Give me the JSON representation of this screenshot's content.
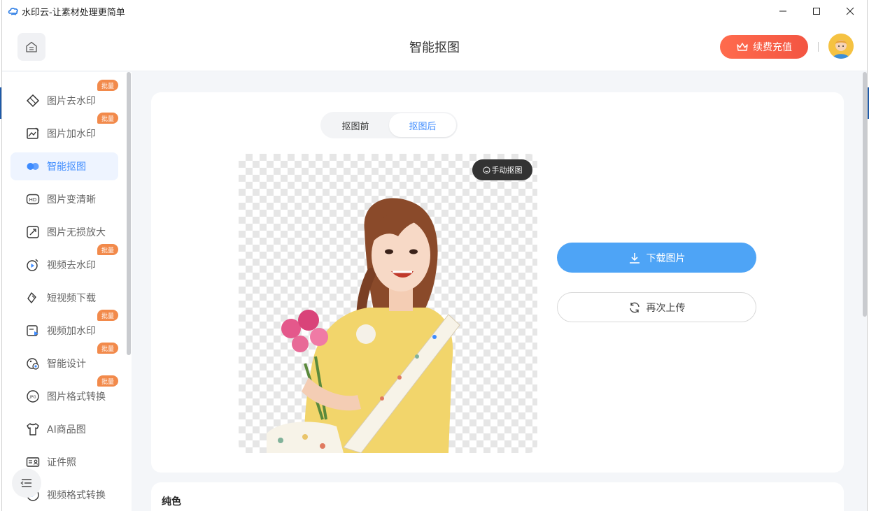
{
  "window": {
    "title": "水印云-让素材处理更简单",
    "controls": [
      "minimize",
      "maximize",
      "close"
    ]
  },
  "header": {
    "page_title": "智能抠图",
    "renew_label": "续费充值",
    "home_icon": "home-icon",
    "avatar": "user-avatar"
  },
  "sidebar": {
    "items": [
      {
        "label": "图片去水印",
        "icon": "eraser-icon",
        "badge": "批量",
        "active": false
      },
      {
        "label": "图片加水印",
        "icon": "image-edit-icon",
        "badge": "批量",
        "active": false
      },
      {
        "label": "智能抠图",
        "icon": "cutout-icon",
        "badge": "",
        "active": true
      },
      {
        "label": "图片变清晰",
        "icon": "hd-icon",
        "badge": "",
        "active": false
      },
      {
        "label": "图片无损放大",
        "icon": "enlarge-icon",
        "badge": "",
        "active": false
      },
      {
        "label": "视频去水印",
        "icon": "video-eraser-icon",
        "badge": "批量",
        "active": false
      },
      {
        "label": "短视频下载",
        "icon": "link-icon",
        "badge": "",
        "active": false
      },
      {
        "label": "视频加水印",
        "icon": "video-add-icon",
        "badge": "批量",
        "active": false
      },
      {
        "label": "智能设计",
        "icon": "palette-icon",
        "badge": "批量",
        "active": false
      },
      {
        "label": "图片格式转换",
        "icon": "jpg-icon",
        "badge": "批量",
        "active": false
      },
      {
        "label": "AI商品图",
        "icon": "tshirt-icon",
        "badge": "",
        "active": false
      },
      {
        "label": "证件照",
        "icon": "id-card-icon",
        "badge": "",
        "active": false
      },
      {
        "label": "视频格式转换",
        "icon": "video-convert-icon",
        "badge": "",
        "active": false
      }
    ]
  },
  "main": {
    "tabs": [
      {
        "label": "抠图前",
        "active": false
      },
      {
        "label": "抠图后",
        "active": true
      }
    ],
    "manual_cutout_label": "手动抠图",
    "download_label": "下载图片",
    "reupload_label": "再次上传",
    "background_section_label": "纯色"
  },
  "colors": {
    "accent": "#3d8bff",
    "primary_button": "#4ea4f6",
    "renew_button": "#f35542",
    "badge": "#f28a4b"
  }
}
